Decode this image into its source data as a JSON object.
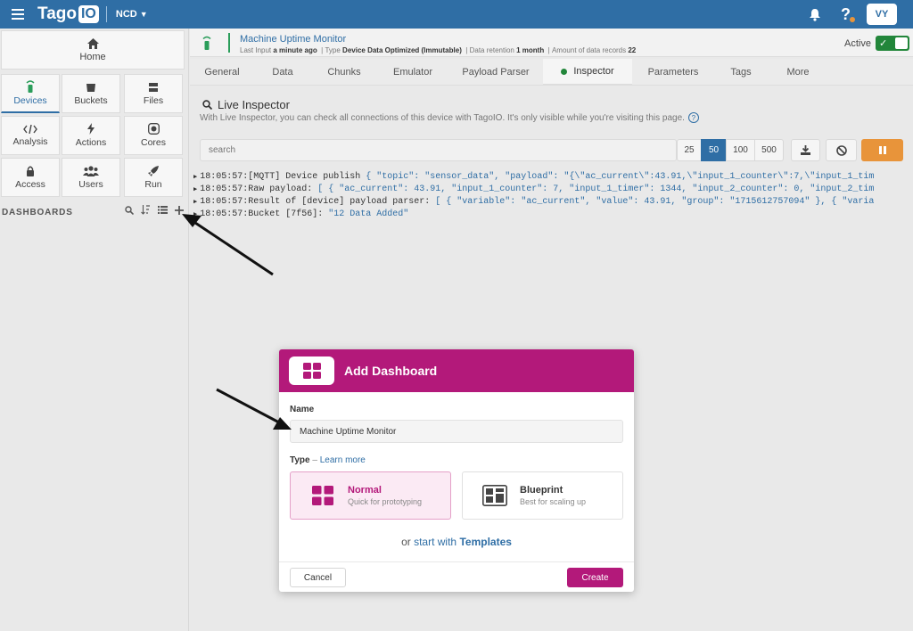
{
  "topbar": {
    "logo_text": "Tago",
    "logo_suffix": "IO",
    "profile": "NCD",
    "avatar": "VY"
  },
  "sidebar": {
    "home": "Home",
    "tiles": [
      "Devices",
      "Buckets",
      "Files",
      "Analysis",
      "Actions",
      "Cores",
      "Access",
      "Users",
      "Run"
    ],
    "dashboards_title": "DASHBOARDS"
  },
  "device": {
    "name": "Machine Uptime Monitor",
    "last_input_label": "Last Input",
    "last_input_value": "a minute ago",
    "type_label": "Type",
    "type_value": "Device Data Optimized (Immutable)",
    "retention_label": "Data retention",
    "retention_value": "1 month",
    "records_label": "Amount of data records",
    "records_value": "22",
    "active_label": "Active"
  },
  "tabs": [
    "General",
    "Data",
    "Chunks",
    "Emulator",
    "Payload Parser",
    "Inspector",
    "Parameters",
    "Tags",
    "More"
  ],
  "inspector": {
    "title": "Live Inspector",
    "description": "With Live Inspector, you can check all connections of this device with TagoIO. It's only visible while you're visiting this page.",
    "search_placeholder": "search",
    "counts": [
      "25",
      "50",
      "100",
      "500"
    ],
    "logs": [
      {
        "time": "18:05:57:",
        "label": "[MQTT] Device publish",
        "payload": "{ \"topic\": \"sensor_data\", \"payload\": \"{\\\"ac_current\\\":43.91,\\\"input_1_counter\\\":7,\\\"input_1_tim"
      },
      {
        "time": "18:05:57:",
        "label": "Raw payload:",
        "payload": "[ { \"ac_current\": 43.91, \"input_1_counter\": 7, \"input_1_timer\": 1344, \"input_2_counter\": 0, \"input_2_tim"
      },
      {
        "time": "18:05:57:",
        "label": "Result of [device] payload parser:",
        "payload": "[ { \"variable\": \"ac_current\", \"value\": 43.91, \"group\": \"1715612757094\" }, { \"varia"
      },
      {
        "time": "18:05:57:",
        "label": "Bucket [7f56]:",
        "payload": "\"12 Data Added\""
      }
    ]
  },
  "modal": {
    "title": "Add Dashboard",
    "name_label": "Name",
    "name_value": "Machine Uptime Monitor",
    "type_label": "Type",
    "type_dash": "–",
    "learn_more": "Learn more",
    "normal_name": "Normal",
    "normal_sub": "Quick for prototyping",
    "blueprint_name": "Blueprint",
    "blueprint_sub": "Best for scaling up",
    "or_text": "or",
    "start_with": "start with",
    "templates": "Templates",
    "cancel": "Cancel",
    "create": "Create"
  },
  "colors": {
    "topbar": "#2f6ea5",
    "accent_pink": "#b3197a",
    "active_green": "#22863a",
    "pause_orange": "#e8943a"
  }
}
